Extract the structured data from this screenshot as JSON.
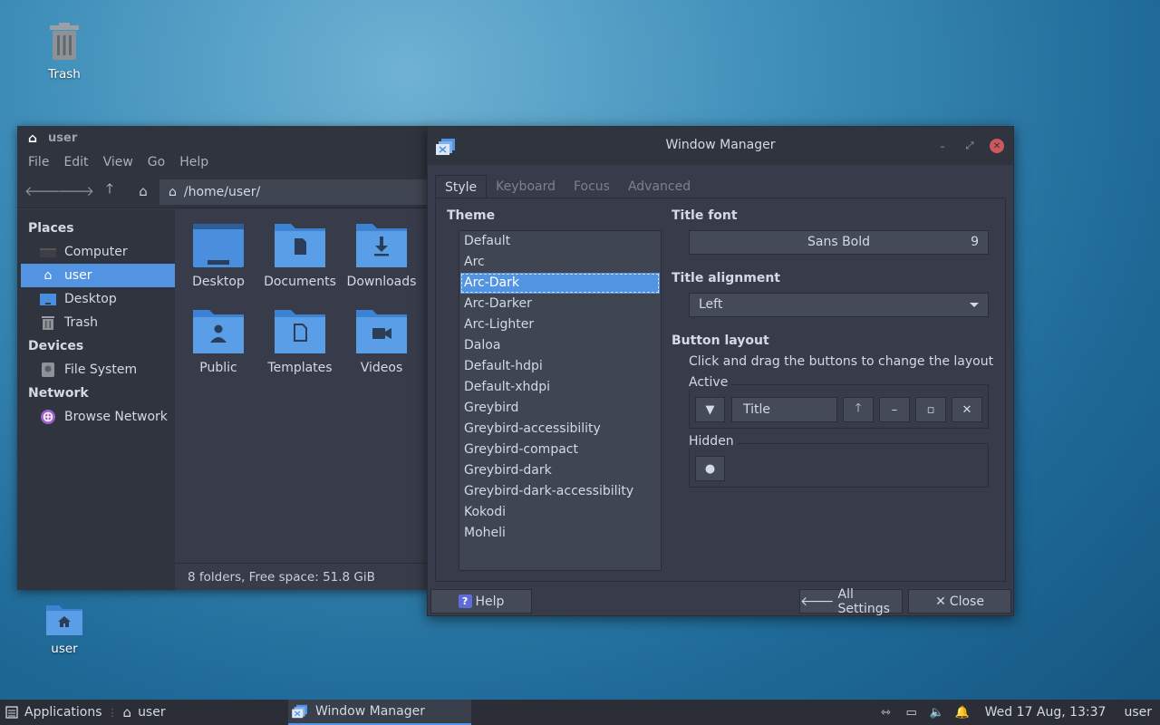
{
  "desktop": {
    "trash_label": "Trash",
    "home_label": "user"
  },
  "file_manager": {
    "title": "user",
    "menu": [
      "File",
      "Edit",
      "View",
      "Go",
      "Help"
    ],
    "path": "/home/user/",
    "sidebar": {
      "places_header": "Places",
      "places": [
        "Computer",
        "user",
        "Desktop",
        "Trash"
      ],
      "devices_header": "Devices",
      "devices": [
        "File System"
      ],
      "network_header": "Network",
      "network": [
        "Browse Network"
      ]
    },
    "folders": [
      "Desktop",
      "Documents",
      "Downloads",
      "Public",
      "Templates",
      "Videos"
    ],
    "status": "8 folders, Free space: 51.8 GiB"
  },
  "window_manager": {
    "title": "Window Manager",
    "tabs": [
      "Style",
      "Keyboard",
      "Focus",
      "Advanced"
    ],
    "theme_label": "Theme",
    "themes": [
      "Default",
      "Arc",
      "Arc-Dark",
      "Arc-Darker",
      "Arc-Lighter",
      "Daloa",
      "Default-hdpi",
      "Default-xhdpi",
      "Greybird",
      "Greybird-accessibility",
      "Greybird-compact",
      "Greybird-dark",
      "Greybird-dark-accessibility",
      "Kokodi",
      "Moheli"
    ],
    "selected_theme": "Arc-Dark",
    "title_font_label": "Title font",
    "title_font_name": "Sans Bold",
    "title_font_size": "9",
    "title_alignment_label": "Title alignment",
    "title_alignment_value": "Left",
    "button_layout_label": "Button layout",
    "button_layout_desc": "Click and drag the buttons to change the layout",
    "active_label": "Active",
    "active_title_button": "Title",
    "hidden_label": "Hidden",
    "help_button": "Help",
    "all_settings_button": "All Settings",
    "close_button": "Close"
  },
  "panel": {
    "applications": "Applications",
    "home": "user",
    "task": "Window Manager",
    "clock": "Wed 17 Aug, 13:37",
    "user": "user"
  },
  "colors": {
    "accent": "#5294e2",
    "window_bg": "#383c4a",
    "header_bg": "#2f343f",
    "close_red": "#cc575d"
  }
}
